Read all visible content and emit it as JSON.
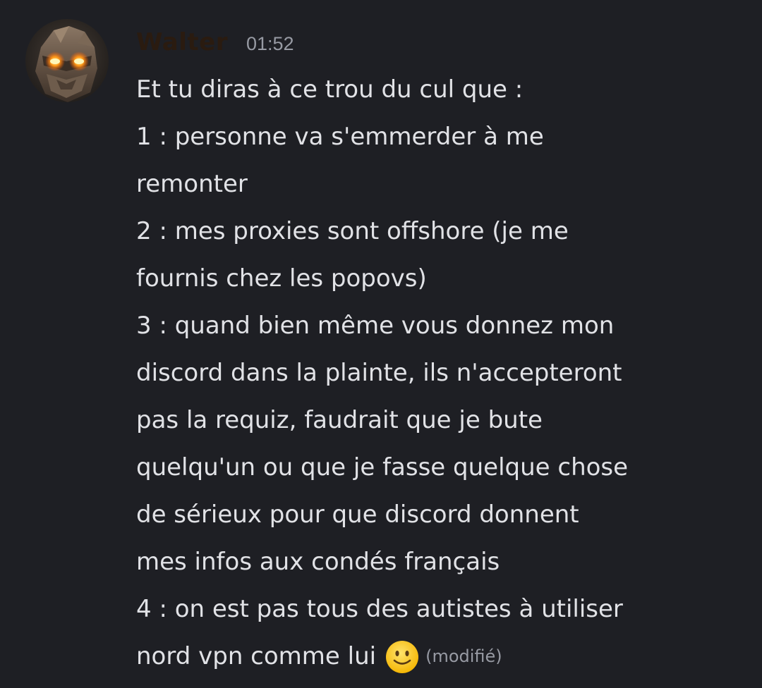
{
  "message": {
    "author": "Walter",
    "timestamp": "01:52",
    "lines": [
      "Et tu diras à ce trou du cul que :",
      "1 : personne va s'emmerder à me",
      "remonter",
      "2 : mes proxies sont offshore (je me",
      "fournis chez les popovs)",
      "3 : quand bien même vous donnez mon",
      "discord dans la plainte, ils n'accepteront",
      "pas la requiz, faudrait que je bute",
      "quelqu'un ou que je fasse quelque chose",
      "de sérieux pour que discord donnent",
      "mes infos aux condés français",
      "4 : on est pas tous des autistes à utiliser",
      "nord vpn comme lui"
    ],
    "emoji": "slightly-smiling-face-icon",
    "edited_label": "(modifié)"
  },
  "colors": {
    "background": "#1e1f24",
    "text": "#e1e2e6",
    "muted": "#979aa3",
    "username": "#2a1b10"
  }
}
